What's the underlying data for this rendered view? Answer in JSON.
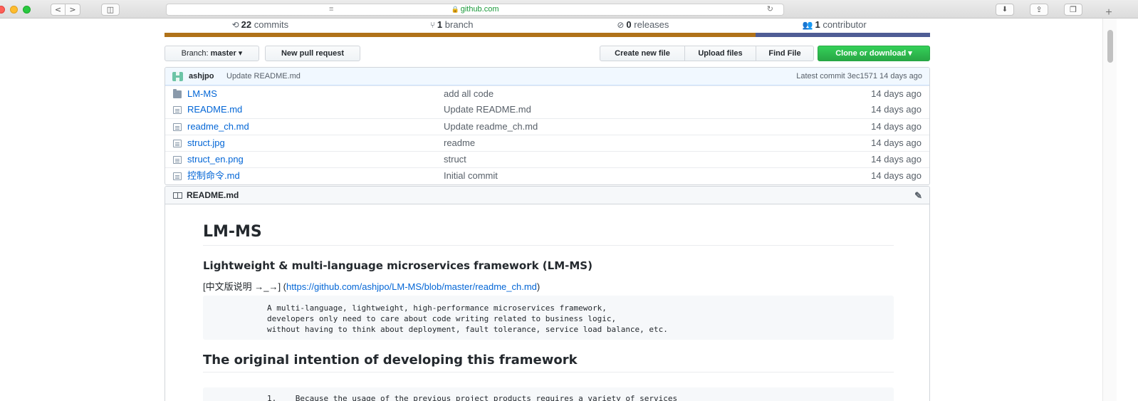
{
  "browser": {
    "url": "github.com",
    "back": "<",
    "forward": ">"
  },
  "stats": {
    "commits_count": "22",
    "commits_label": "commits",
    "branches_count": "1",
    "branches_label": "branch",
    "releases_count": "0",
    "releases_label": "releases",
    "contributors_count": "1",
    "contributors_label": "contributor"
  },
  "languages": {
    "colors": [
      "#b07219",
      "#4f5d95"
    ]
  },
  "filenav": {
    "branch_prefix": "Branch:",
    "branch_name": "master",
    "new_pr": "New pull request",
    "create_file": "Create new file",
    "upload_files": "Upload files",
    "find_file": "Find File",
    "clone": "Clone or download"
  },
  "commit": {
    "author": "ashjpo",
    "message": "Update README.md",
    "meta": "Latest commit 3ec1571 14 days ago"
  },
  "files": [
    {
      "name": "LM-MS",
      "type": "dir",
      "message": "add all code",
      "age": "14 days ago"
    },
    {
      "name": "README.md",
      "type": "file",
      "message": "Update README.md",
      "age": "14 days ago"
    },
    {
      "name": "readme_ch.md",
      "type": "file",
      "message": "Update readme_ch.md",
      "age": "14 days ago"
    },
    {
      "name": "struct.jpg",
      "type": "file",
      "message": "readme",
      "age": "14 days ago"
    },
    {
      "name": "struct_en.png",
      "type": "file",
      "message": "struct",
      "age": "14 days ago"
    },
    {
      "name": "控制命令.md",
      "type": "file",
      "message": "Initial commit",
      "age": "14 days ago"
    }
  ],
  "readme": {
    "header": "README.md",
    "h1": "LM-MS",
    "h3": "Lightweight & multi-language microservices framework (LM-MS)",
    "cn_prefix": "[中文版说明 →_→] (",
    "cn_link": "https://github.com/ashjpo/LM-MS/blob/master/readme_ch.md",
    "cn_suffix": ")",
    "code1": "A multi-language, lightweight, high-performance microservices framework,\ndevelopers only need to care about code writing related to business logic,\nwithout having to think about deployment, fault tolerance, service load balance, etc.",
    "h2": "The original intention of developing this framework",
    "code2": "1.    Because the usage of the previous project products requires a variety of services"
  }
}
